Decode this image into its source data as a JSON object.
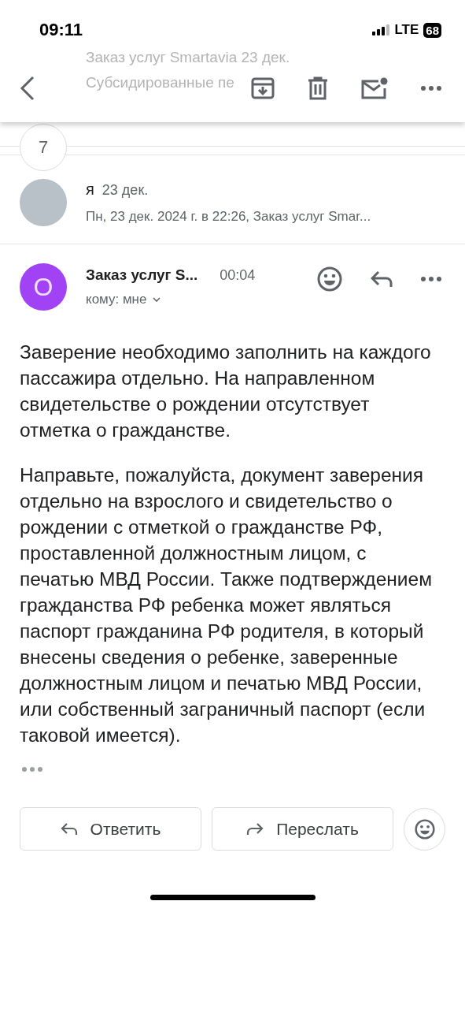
{
  "status_bar": {
    "time": "09:11",
    "network": "LTE",
    "battery": "68"
  },
  "background_thread_row": {
    "sender": "Заказ услуг Smartavia",
    "date": "23 дек.",
    "snippet": "Субсидированные пе"
  },
  "collapsed_count": "7",
  "messages": [
    {
      "kind": "collapsed",
      "sender": "я",
      "date": "23 дек.",
      "preview": "Пн, 23 дек. 2024 г. в 22:26, Заказ услуг Smar..."
    },
    {
      "kind": "expanded",
      "avatar_letter": "O",
      "sender": "Заказ услуг S...",
      "time": "00:04",
      "recipient": "кому: мне",
      "paragraphs": [
        "Заверение необходимо заполнить на каждого пассажира отдельно. На направленном свидетельстве о рождении отсутствует отметка о гражданстве.",
        "Направьте, пожалуйста, документ заверения отдельно на взрослого и свидетельство о рождении с отметкой о гражданстве РФ, проставленной должностным лицом, с печатью МВД России. Также подтверждением гражданства РФ ребенка может являться паспорт гражданина РФ родителя, в который внесены сведения о ребенке, заверенные должностным лицом и печатью МВД России, или собственный заграничный паспорт (если таковой имеется)."
      ]
    }
  ],
  "actions": [
    {
      "kind": "reply",
      "label": "Ответить"
    },
    {
      "kind": "forward",
      "label": "Переслать"
    }
  ]
}
